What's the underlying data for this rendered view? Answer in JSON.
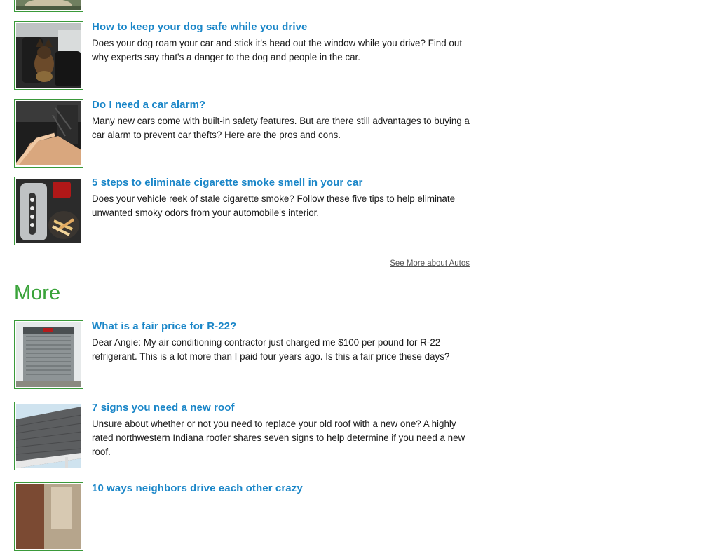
{
  "autos_articles": [
    {
      "title": "How to keep your dog safe while you drive",
      "description": "Does your dog roam your car and stick it's head out the window while you drive? Find out why experts say that's a danger to the dog and people in the car.",
      "image_icon": "dog-in-car-image"
    },
    {
      "title": "Do I need a car alarm?",
      "description": "Many new cars come with built-in safety features. But are there still advantages to buying a car alarm to prevent car thefts? Here are the pros and cons.",
      "image_icon": "car-alarm-image"
    },
    {
      "title": "5 steps to eliminate cigarette smoke smell in your car",
      "description": "Does your vehicle reek of stale cigarette smoke? Follow these five tips to help eliminate unwanted smoky odors from your automobile's interior.",
      "image_icon": "cigarette-ashtray-image"
    }
  ],
  "see_more_label": "See More about Autos",
  "more_section": {
    "heading": "More",
    "articles": [
      {
        "title": "What is a fair price for R-22?",
        "description": "Dear Angie: My air conditioning contractor just charged me $100 per pound for R-22 refrigerant. This is a lot more than I paid four years ago. Is this a fair price these days?",
        "image_icon": "ac-unit-image"
      },
      {
        "title": "7 signs you need a new roof",
        "description": "Unsure about whether or not you need to replace your old roof with a new one? A highly rated northwestern Indiana roofer shares seven signs to help determine if you need a new roof.",
        "image_icon": "roof-image"
      },
      {
        "title": "10 ways neighbors drive each other crazy",
        "description": "",
        "image_icon": "neighbors-image"
      }
    ]
  },
  "colors": {
    "link": "#1a86c8",
    "heading_green": "#3aa33a",
    "thumb_border": "#3a9a3a",
    "rule": "#9a9a9a"
  }
}
